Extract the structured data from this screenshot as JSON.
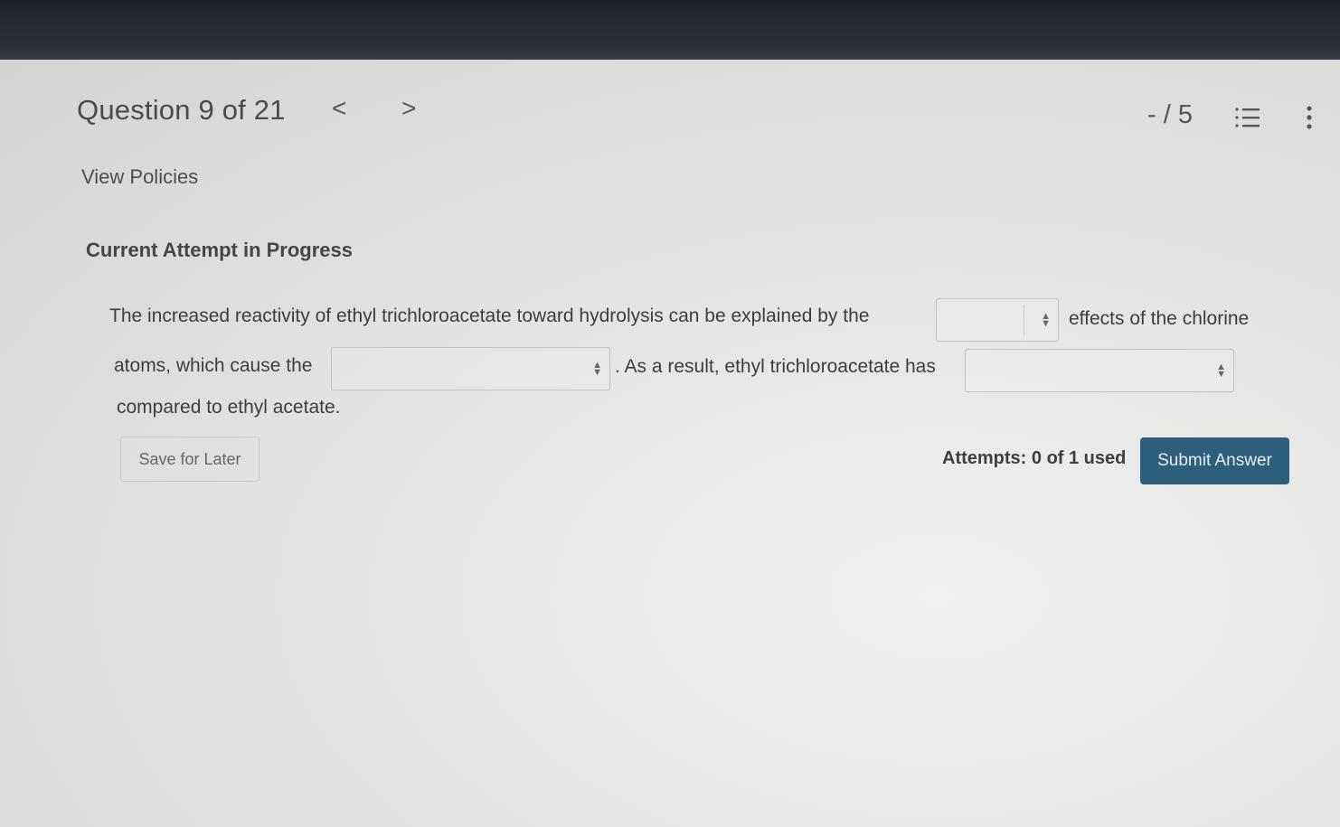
{
  "header": {
    "question_label": "Question 9 of 21",
    "prev_icon": "<",
    "next_icon": ">",
    "score": "- / 5",
    "list_icon": "list-icon",
    "more_icon": "more-vertical-icon"
  },
  "links": {
    "view_policies": "View Policies"
  },
  "attempt": {
    "heading": "Current Attempt in Progress"
  },
  "question": {
    "part1": "The increased reactivity of ethyl trichloroacetate toward hydrolysis can be explained by the",
    "part2": "effects of the chlorine",
    "part3": "atoms, which cause the",
    "part4": ". As a result, ethyl trichloroacetate has",
    "part5": "compared to ethyl acetate.",
    "dropdown1_value": "",
    "dropdown2_value": "",
    "dropdown3_value": ""
  },
  "footer": {
    "save_label": "Save for Later",
    "attempts_text": "Attempts: 0 of 1 used",
    "submit_label": "Submit Answer"
  },
  "colors": {
    "submit_bg": "#2d5e7c",
    "bezel": "#1f2329"
  }
}
